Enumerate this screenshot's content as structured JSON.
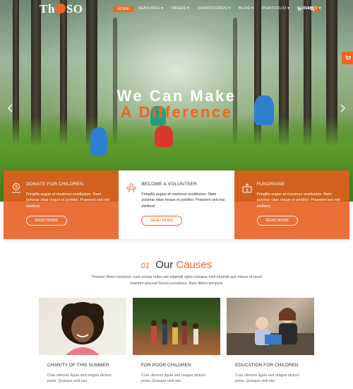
{
  "brand": {
    "logo_text_before": "Th",
    "logo_text_after": "SO",
    "accent": "#f26522"
  },
  "nav": {
    "items": [
      {
        "label": "HOME",
        "active": true
      },
      {
        "label": "FEATURES ▾",
        "active": false
      },
      {
        "label": "PAGES ▾",
        "active": false
      },
      {
        "label": "SHORTCODES ▾",
        "active": false
      },
      {
        "label": "BLOG ▾",
        "active": false
      },
      {
        "label": "PORTFOLIO ▾",
        "active": false
      },
      {
        "label": "CONTACT ▾",
        "active": false
      }
    ],
    "cart_label": "Cart",
    "cart_count": "0"
  },
  "hero": {
    "line1": "We Can Make",
    "line2": "A Difference"
  },
  "cards": [
    {
      "title": "DONATE FOR CHILDREN",
      "text": "Fringilla augue at maximus vestibulum. Nam pulvinar vitae neque et porttitor. Praesent sed nisi eleifend.",
      "button": "READ MORE",
      "icon": "donate-icon"
    },
    {
      "title": "BECOME A VOLUNTEER",
      "text": "Fringilla augue at maximus vestibulum. Nam pulvinar vitae neque et porttitor. Praesent sed nisi eleifend.",
      "button": "READ MORE",
      "icon": "volunteer-icon"
    },
    {
      "title": "FUNDRAISE",
      "text": "Fringilla augue at maximus vestibulum. Nam pulvinar vitae neque et porttitor. Praesent sed nisi eleifend.",
      "button": "READ MORE",
      "icon": "fundraise-icon"
    }
  ],
  "causes_section": {
    "number": "01",
    "title_word1": "Our",
    "title_word2": "Causes",
    "description": "Thomso libero tempore, cum soluta nobis est eligendi optio cumque nihil impedit quo minus id quod maxime placeat facere possimus. Nam libero tempore",
    "items": [
      {
        "title": "CHARITY OF THIS SUMMER",
        "text": "Cras ultricies ligula sed magna dictum porta. Quisque velit nisi."
      },
      {
        "title": "FOR POOR CHILDREN",
        "text": "Cras ultricies ligula sed magna dictum porta. Quisque velit nisi."
      },
      {
        "title": "EDUCATION FOR CHILDREN",
        "text": "Cras ultricies ligula sed magna dictum porta. Quisque velit nisi."
      }
    ]
  }
}
